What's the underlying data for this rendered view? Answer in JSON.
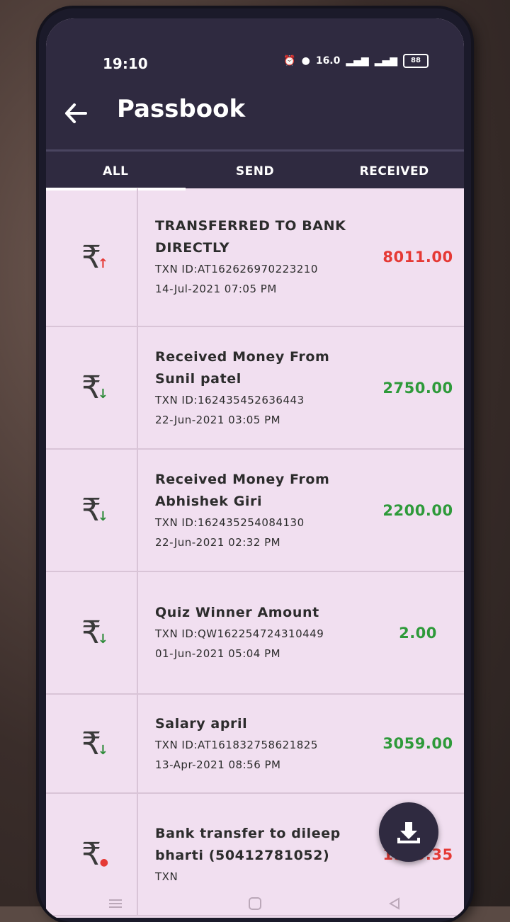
{
  "status_bar": {
    "time": "19:10",
    "icons": [
      "alarm-icon",
      "location-icon",
      "data-speed-icon",
      "signal-icon",
      "signal-icon-2",
      "battery-icon"
    ],
    "data_speed": "16.0",
    "battery": "88"
  },
  "header": {
    "title": "Passbook"
  },
  "tabs": [
    {
      "label": "ALL",
      "active": true
    },
    {
      "label": "SEND",
      "active": false
    },
    {
      "label": "RECEIVED",
      "active": false
    }
  ],
  "transactions": [
    {
      "title": "TRANSFERRED TO BANK DIRECTLY",
      "txn": "TXN ID:AT162626970223210",
      "date": "14-Jul-2021 07:05 PM",
      "amount": "8011.00",
      "direction": "debit",
      "color": "#e53935"
    },
    {
      "title": "Received Money From Sunil patel",
      "txn": "TXN ID:162435452636443",
      "date": "22-Jun-2021 03:05 PM",
      "amount": "2750.00",
      "direction": "credit",
      "color": "#2e9a3a"
    },
    {
      "title": "Received Money From Abhishek Giri",
      "txn": "TXN ID:162435254084130",
      "date": "22-Jun-2021 02:32 PM",
      "amount": "2200.00",
      "direction": "credit",
      "color": "#2e9a3a"
    },
    {
      "title": "Quiz Winner Amount",
      "txn": "TXN ID:QW162254724310449",
      "date": "01-Jun-2021 05:04 PM",
      "amount": "2.00",
      "direction": "credit",
      "color": "#2e9a3a"
    },
    {
      "title": "Salary april",
      "txn": "TXN ID:AT161832758621825",
      "date": "13-Apr-2021 08:56 PM",
      "amount": "3059.00",
      "direction": "credit",
      "color": "#2e9a3a"
    },
    {
      "title": "Bank transfer to dileep bharti (50412781052)",
      "txn": "TXN",
      "date": "",
      "amount": "1900.35",
      "direction": "debit",
      "color": "#e53935"
    }
  ],
  "icons": {
    "rupee": "₹",
    "back": "back-arrow-icon",
    "download": "download-icon"
  }
}
